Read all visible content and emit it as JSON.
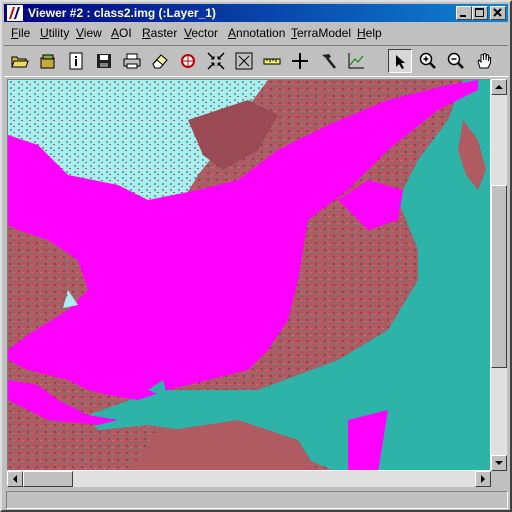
{
  "window": {
    "title": "Viewer #2 : class2.img (:Layer_1)"
  },
  "menu": [
    {
      "label": "File",
      "u": "F",
      "rest": "ile"
    },
    {
      "label": "Utility",
      "u": "U",
      "rest": "tility"
    },
    {
      "label": "View",
      "u": "V",
      "rest": "iew"
    },
    {
      "label": "AOI",
      "u": "A",
      "rest": "OI"
    },
    {
      "label": "Raster",
      "u": "R",
      "rest": "aster"
    },
    {
      "label": "Vector",
      "u": "V",
      "rest": "ector"
    },
    {
      "label": "Annotation",
      "u": "A",
      "rest": "nnotation"
    },
    {
      "label": "TerraModel",
      "u": "T",
      "rest": "erraModel"
    },
    {
      "label": "Help",
      "u": "H",
      "rest": "elp"
    }
  ],
  "toolbar": {
    "tools": [
      "open-folder-icon",
      "new-layer-icon",
      "info-icon",
      "save-icon",
      "print-icon",
      "eraser-icon",
      "target-icon",
      "zoom-fit-icon",
      "expand-icon",
      "measure-icon",
      "crosshair-icon",
      "hammer-icon",
      "profile-chart-icon",
      "pointer-icon",
      "zoom-in-icon",
      "zoom-out-icon",
      "pan-hand-icon"
    ],
    "pressed": "pointer-icon"
  },
  "colors": {
    "land": "#b05a62",
    "water_class": "#ff00ff",
    "river": "#2eb3a8",
    "vegetation": "#4c8a8f",
    "bright": "#a8f0f0"
  }
}
